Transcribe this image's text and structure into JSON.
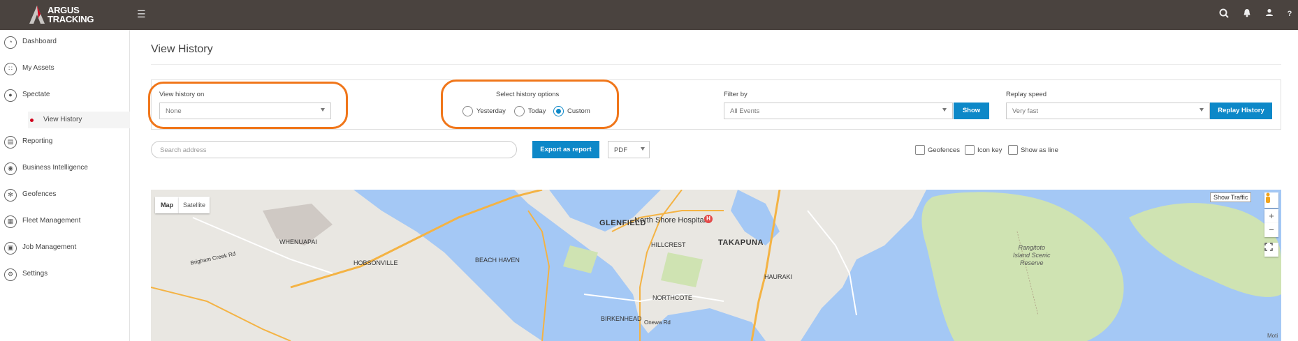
{
  "header": {
    "logo_line1": "ARGUS",
    "logo_line2": "TRACKING",
    "icons": [
      "search-icon",
      "bell-icon",
      "user-icon",
      "help-icon"
    ]
  },
  "sidebar": {
    "items": [
      {
        "label": "Dashboard",
        "icon": "dashboard-icon"
      },
      {
        "label": "My Assets",
        "icon": "assets-icon"
      },
      {
        "label": "Spectate",
        "icon": "location-pin-icon"
      },
      {
        "label": "Reporting",
        "icon": "reporting-icon"
      },
      {
        "label": "Business Intelligence",
        "icon": "intelligence-icon"
      },
      {
        "label": "Geofences",
        "icon": "geofence-icon"
      },
      {
        "label": "Fleet Management",
        "icon": "fleet-icon"
      },
      {
        "label": "Job Management",
        "icon": "job-icon"
      },
      {
        "label": "Settings",
        "icon": "gear-icon"
      }
    ],
    "sub_item": "View History"
  },
  "page": {
    "title": "View History"
  },
  "filters": {
    "history_on_label": "View history on",
    "history_on_value": "None",
    "options_label": "Select history options",
    "options": [
      "Yesterday",
      "Today",
      "Custom"
    ],
    "selected_option": "Custom",
    "filter_label": "Filter by",
    "filter_value": "All Events",
    "show_button": "Show",
    "speed_label": "Replay speed",
    "speed_value": "Very fast",
    "replay_button": "Replay History"
  },
  "toolbar": {
    "search_placeholder": "Search address",
    "export_button": "Export as report",
    "format_value": "PDF",
    "checkboxes": [
      "Geofences",
      "Icon key",
      "Show as line"
    ]
  },
  "map": {
    "tabs": [
      "Map",
      "Satellite"
    ],
    "show_traffic": "Show Traffic",
    "zoom_in": "+",
    "zoom_out": "−",
    "attribution": "Moti",
    "labels": {
      "glenfield": "GLENFIELD",
      "north_shore_hospital": "North Shore Hospital",
      "takapuna": "TAKAPUNA",
      "whenuapai": "WHENUAPAI",
      "hobsonville": "HOBSONVILLE",
      "beach_haven": "BEACH HAVEN",
      "hillcrest": "HILLCREST",
      "hauraki": "HAURAKI",
      "northcote": "NORTHCOTE",
      "birkenhead": "BIRKENHEAD",
      "rangitoto1": "Rangitoto",
      "rangitoto2": "Island Scenic",
      "rangitoto3": "Reserve",
      "brigham_creek_rd": "Brigham Creek Rd",
      "onewa_rd": "Onewa Rd"
    },
    "colors": {
      "water": "#a4c8f5",
      "land": "#e9e7e2",
      "park": "#cfe3b2",
      "motorway": "#f4b344"
    }
  },
  "colors": {
    "topbar": "#4a433f",
    "accent": "#0d88c8",
    "highlight": "#f0761a"
  }
}
